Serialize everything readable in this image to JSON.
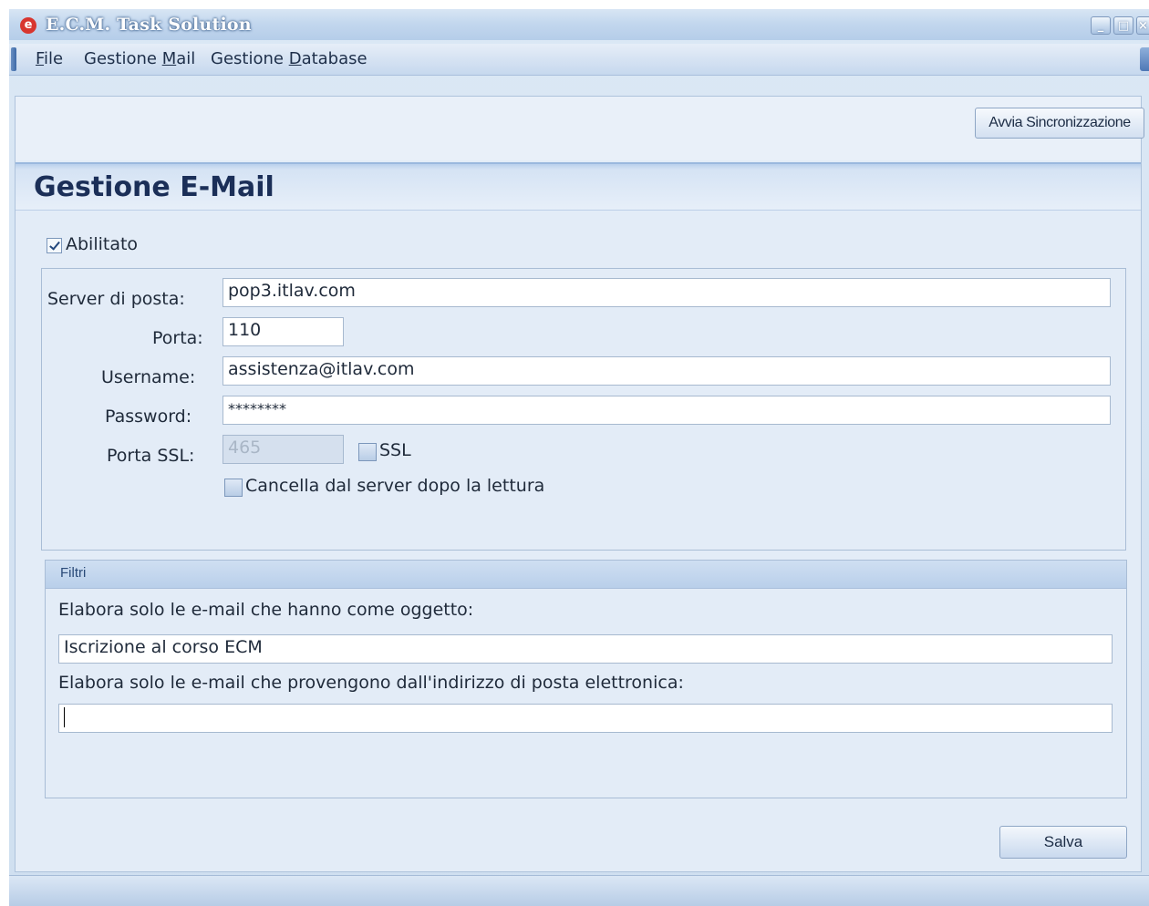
{
  "window": {
    "title": "E.C.M. Task Solution",
    "app_icon_glyph": "e",
    "controls": {
      "minimize": "_",
      "maximize": "□",
      "close": "×"
    }
  },
  "menu": {
    "items": [
      {
        "label_pre": "",
        "label_accel": "F",
        "label_post": "ile"
      },
      {
        "label_pre": "Gestione ",
        "label_accel": "M",
        "label_post": "ail"
      },
      {
        "label_pre": "Gestione ",
        "label_accel": "D",
        "label_post": "atabase"
      }
    ]
  },
  "toolbar": {
    "sync_button": "Avvia Sincronizzazione"
  },
  "page": {
    "title": "Gestione E-Mail"
  },
  "form": {
    "enabled": {
      "label": "Abilitato",
      "checked": true
    },
    "server": {
      "label": "Server di posta:",
      "value": "pop3.itlav.com"
    },
    "port": {
      "label": "Porta:",
      "value": "110"
    },
    "username": {
      "label": "Username:",
      "value": "assistenza@itlav.com"
    },
    "password": {
      "label": "Password:",
      "value": "********"
    },
    "ssl_port": {
      "label": "Porta SSL:",
      "value": "465",
      "disabled": true
    },
    "ssl": {
      "label": "SSL",
      "checked": false
    },
    "delete_after_read": {
      "label": "Cancella dal server dopo la lettura",
      "checked": false
    }
  },
  "filters": {
    "title": "Filtri",
    "subject_label": "Elabora solo le e-mail che hanno come oggetto:",
    "subject_value": "Iscrizione al corso ECM",
    "sender_label": "Elabora solo le e-mail che provengono dall'indirizzo di posta elettronica:",
    "sender_value": ""
  },
  "actions": {
    "save": "Salva"
  },
  "colors": {
    "title_text": "#1b2f58",
    "frame": "#cfdff0",
    "accent": "#d8362f"
  }
}
